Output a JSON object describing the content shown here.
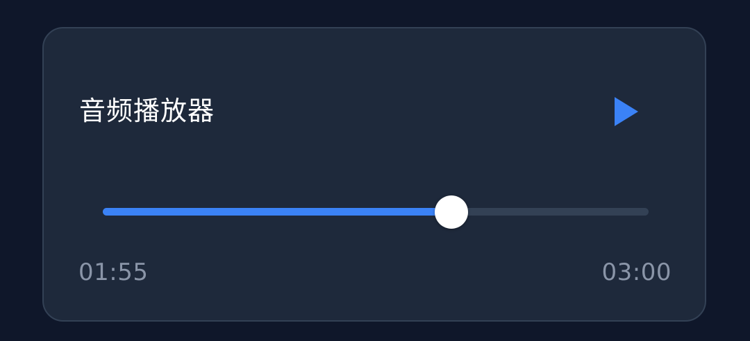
{
  "player": {
    "title": "音频播放器",
    "play_icon": "play-icon",
    "current_time": "01:55",
    "total_time": "03:00",
    "progress": 0.6389
  },
  "colors": {
    "background": "#0f172a",
    "card": "#1e293b",
    "card_border": "#334155",
    "accent": "#3b82f6",
    "track": "#334155",
    "thumb": "#ffffff",
    "time_text": "#8a95a8"
  }
}
